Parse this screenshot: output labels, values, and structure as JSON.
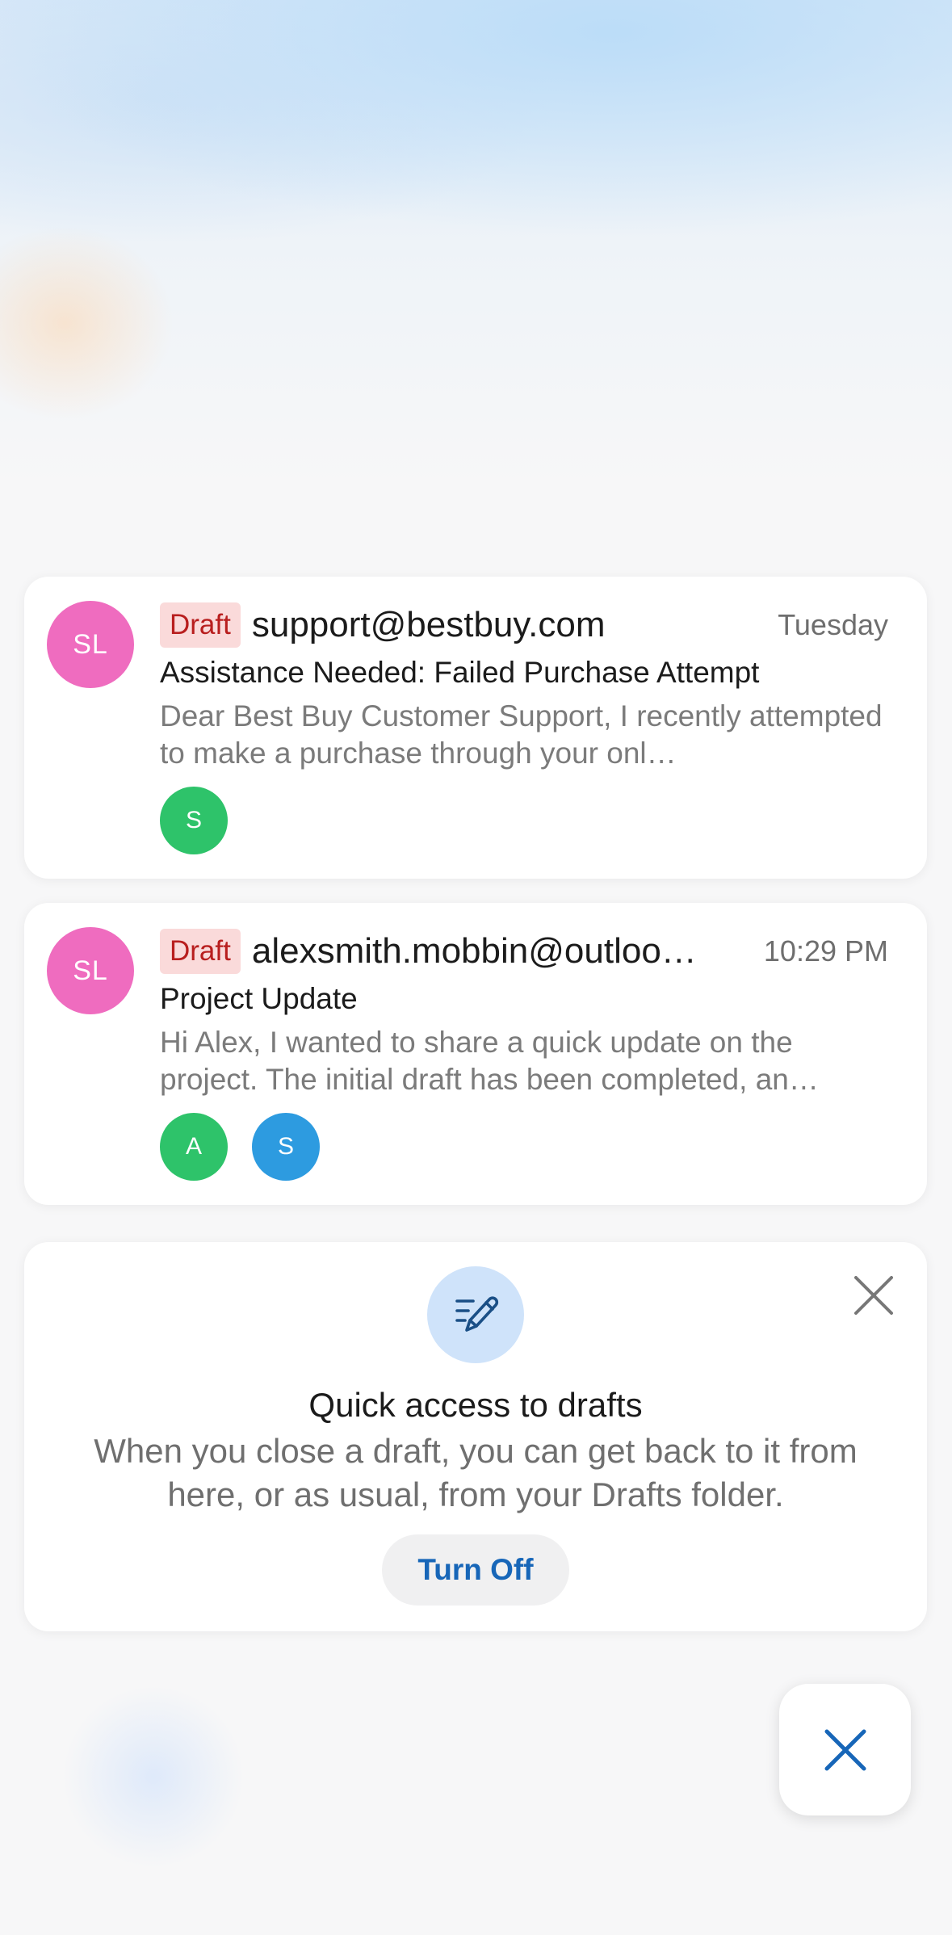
{
  "drafts": [
    {
      "avatar_initials": "SL",
      "badge": "Draft",
      "sender": "support@bestbuy.com",
      "time": "Tuesday",
      "subject": "Assistance Needed: Failed Purchase Attempt",
      "preview": "Dear Best Buy Customer Support, I recently attempted to make a purchase through your onl…",
      "recipients": [
        "S"
      ]
    },
    {
      "avatar_initials": "SL",
      "badge": "Draft",
      "sender": "alexsmith.mobbin@outloo…",
      "time": "10:29 PM",
      "subject": "Project Update",
      "preview": "Hi Alex, I wanted to share a quick update on the project. The initial draft has been completed, an…",
      "recipients": [
        "A",
        "S"
      ]
    }
  ],
  "tip": {
    "icon": "compose-pencil-icon",
    "title": "Quick access to drafts",
    "body": "When you close a draft, you can get back to it from here, or as usual, from your Drafts folder.",
    "button_label": "Turn Off",
    "close_icon": "close-icon"
  },
  "fab": {
    "icon": "close-icon"
  },
  "colors": {
    "avatar": "#ef6cbf",
    "draft_badge_bg": "#fadada",
    "draft_badge_text": "#b81e1e",
    "recipient_green": "#2ec36a",
    "recipient_blue": "#2d9be0",
    "accent_blue": "#1766b8"
  }
}
